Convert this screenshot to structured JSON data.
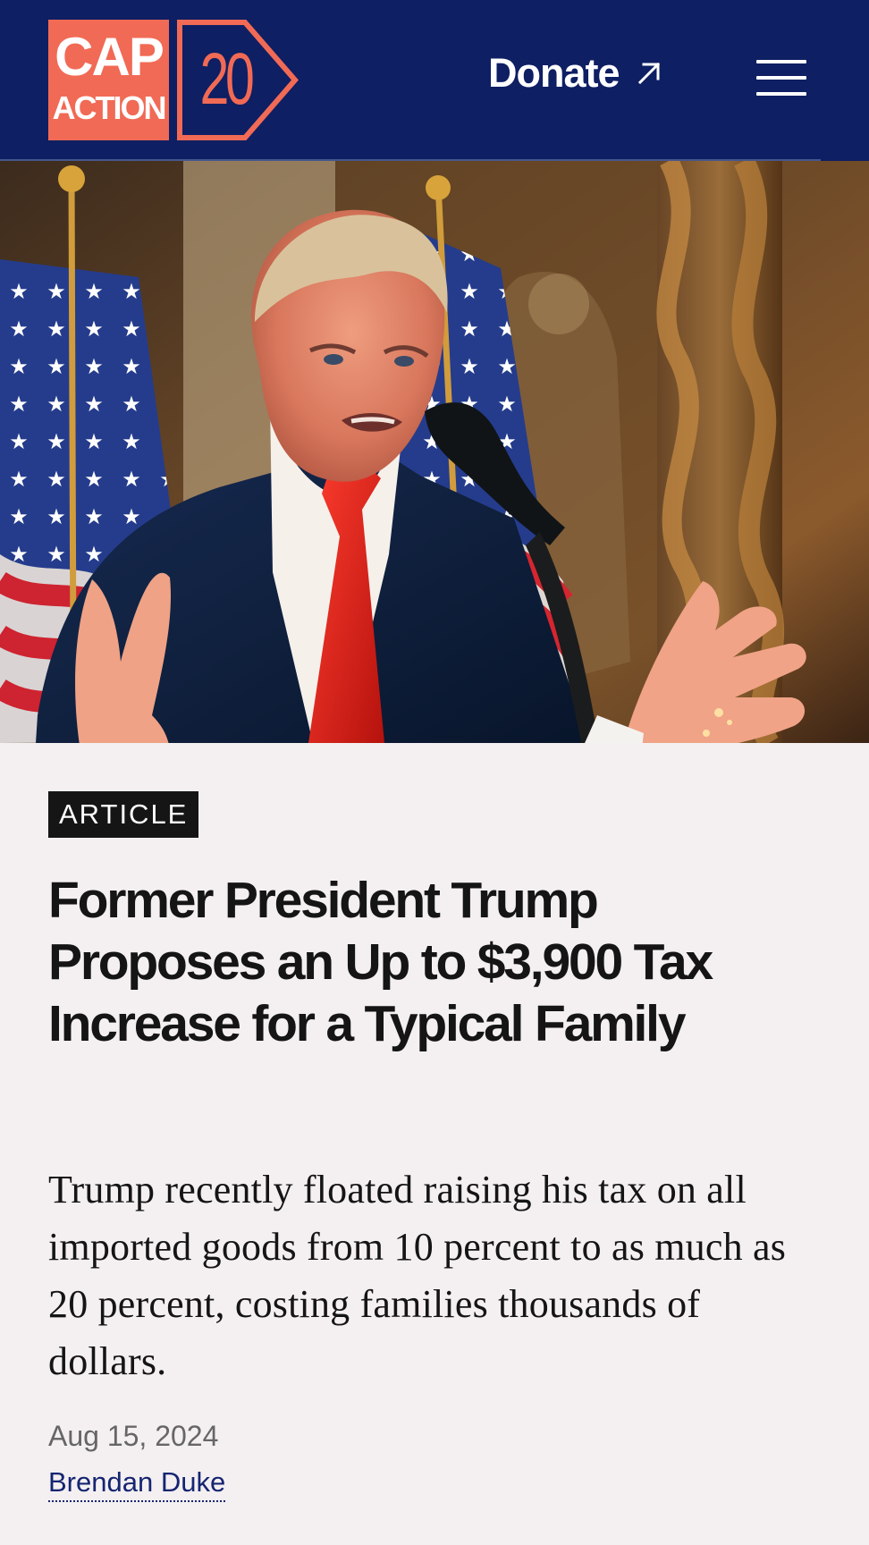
{
  "header": {
    "logo": {
      "line1": "CAP",
      "line2": "ACTION",
      "number": "20"
    },
    "donate_label": "Donate",
    "donate_icon": "external-link-arrow-icon",
    "menu_icon": "hamburger-menu-icon"
  },
  "hero": {
    "image_description": "Donald Trump speaking at a microphone in front of American flags"
  },
  "article": {
    "type_label": "ARTICLE",
    "headline": "Former President Trump Proposes an Up to $3,900 Tax Increase for a Typical Family",
    "summary": "Trump recently floated raising his tax on all imported goods from 10 percent to as much as 20 percent, costing families thousands of dollars.",
    "date": "Aug 15, 2024",
    "author": "Brendan Duke"
  },
  "colors": {
    "header_bg": "#0e1f63",
    "logo_accent": "#f16a55",
    "page_bg": "#f4f0f1",
    "tag_bg": "#151515",
    "author_link": "#152571"
  }
}
